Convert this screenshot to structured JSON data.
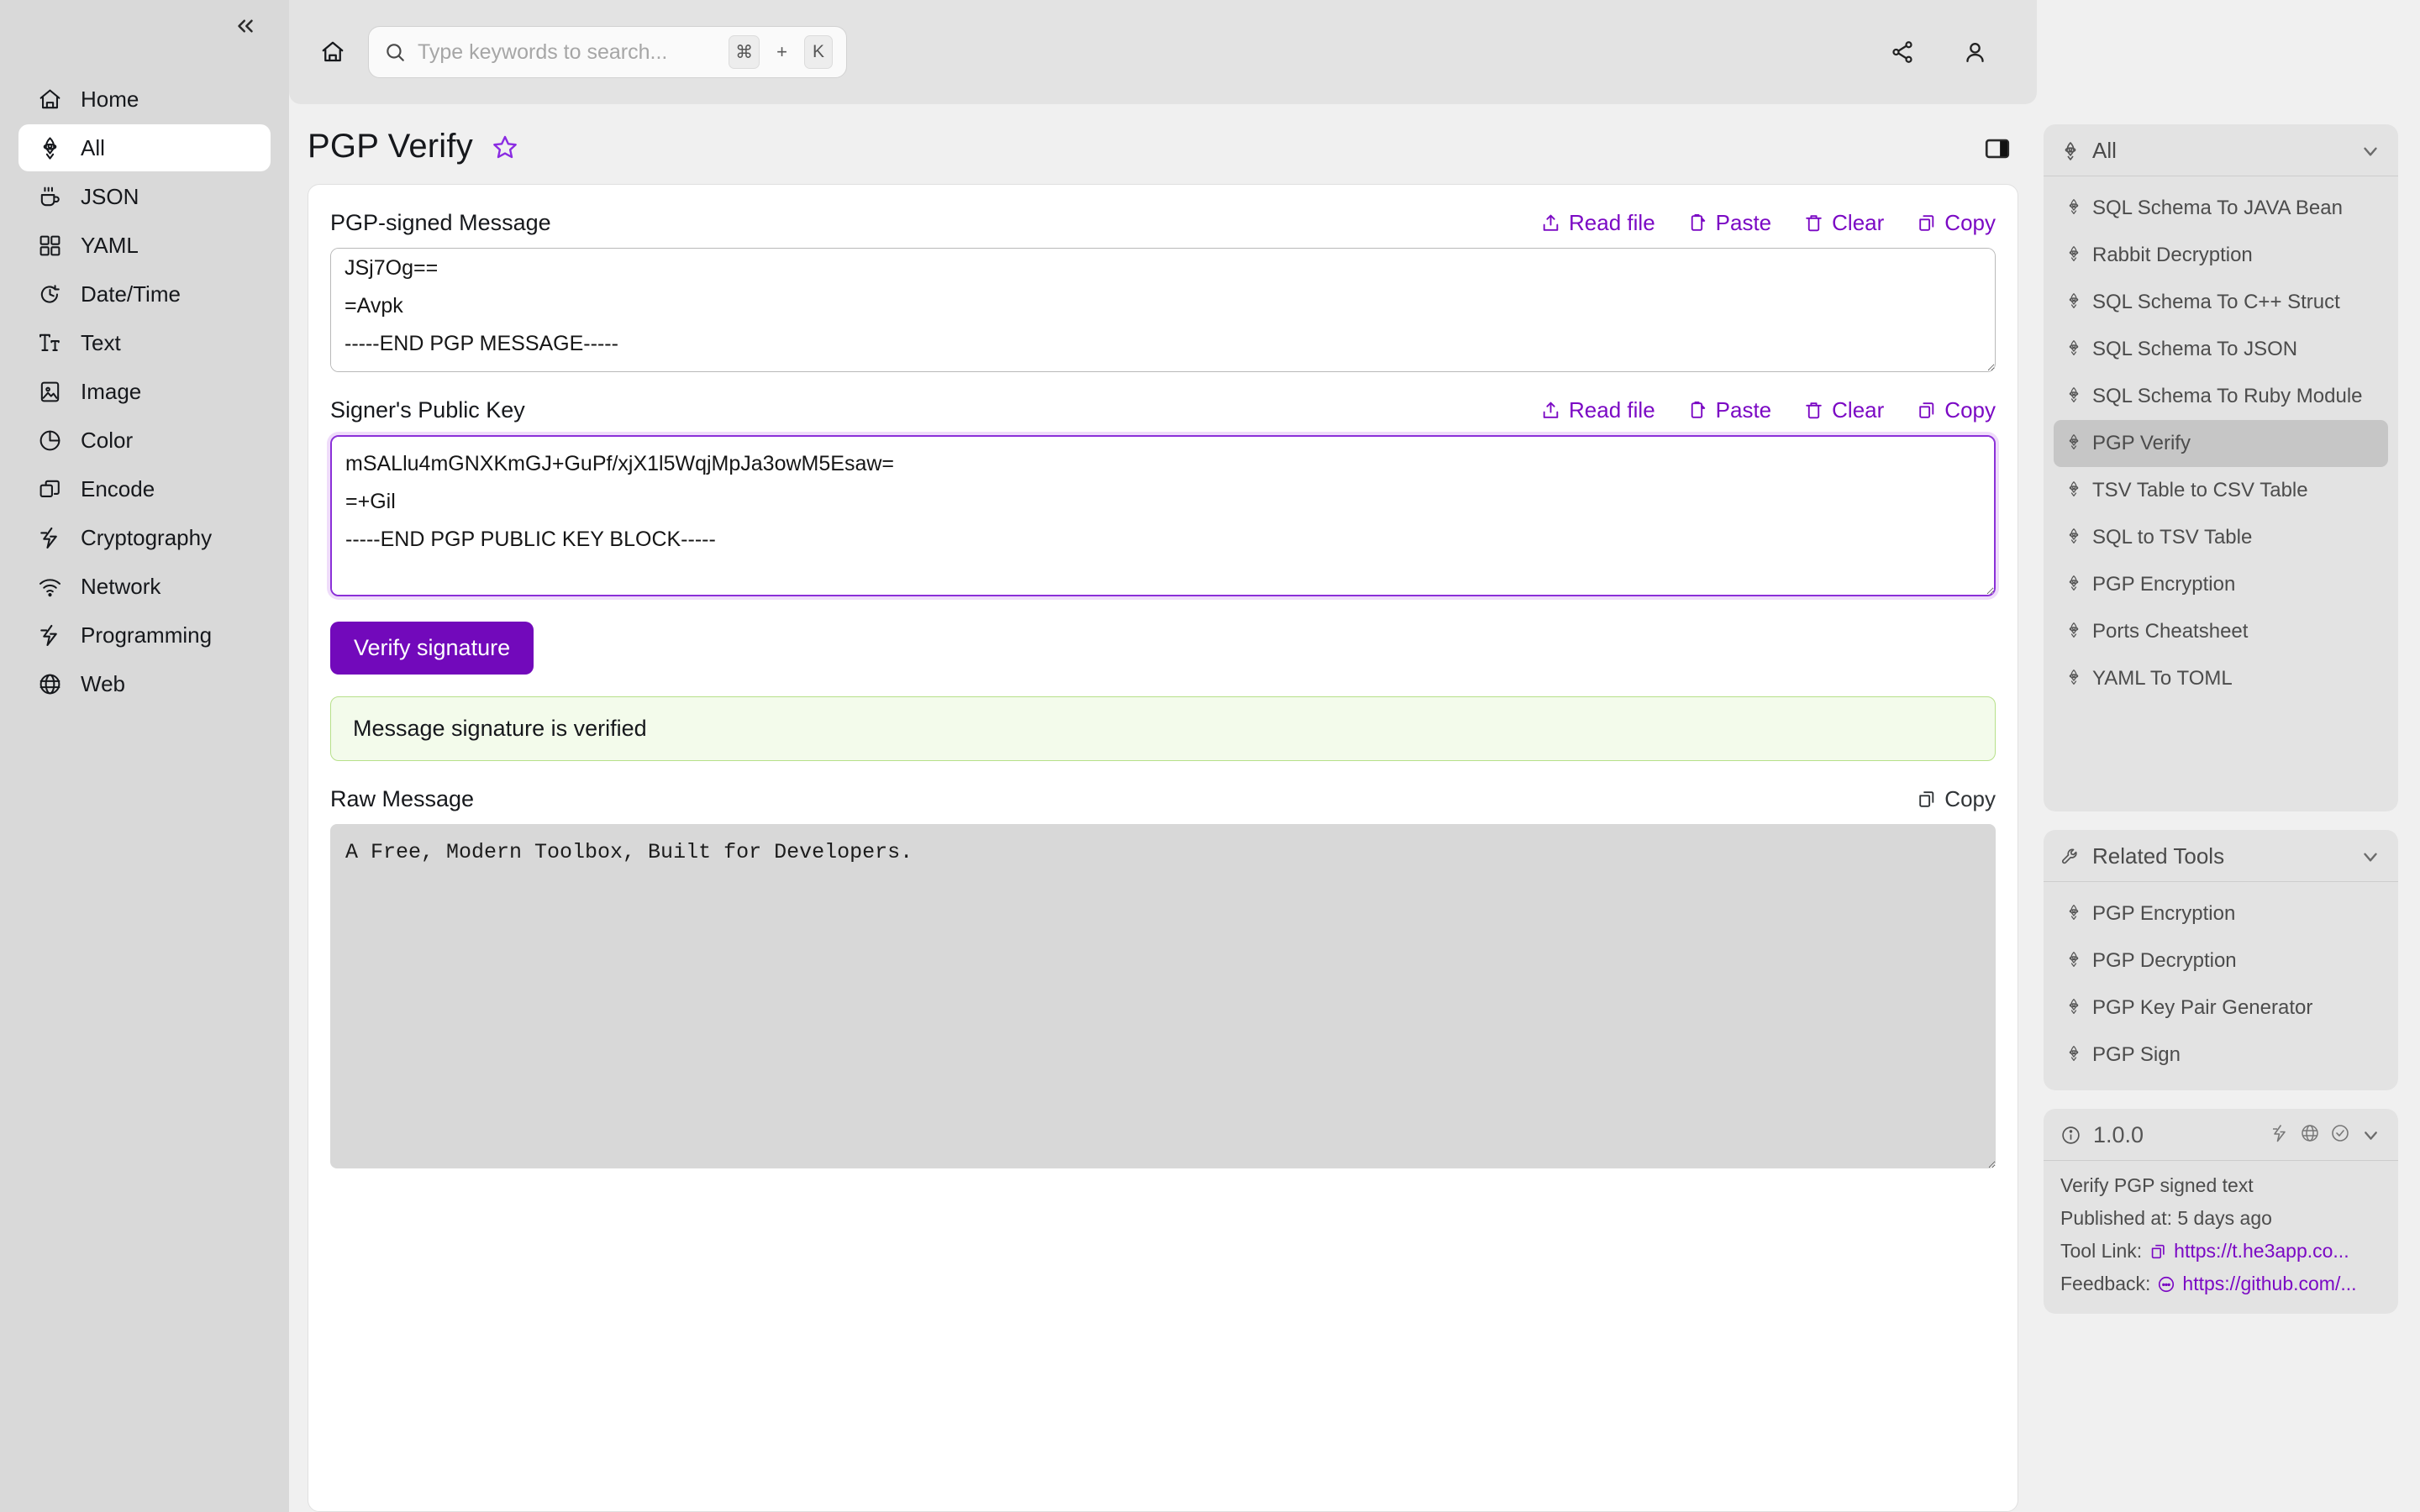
{
  "sidebar": {
    "collapse_icon": "chevrons-left-icon",
    "items": [
      {
        "label": "Home",
        "icon": "home-icon",
        "active": false
      },
      {
        "label": "All",
        "icon": "rocket-icon",
        "active": true
      },
      {
        "label": "JSON",
        "icon": "coffee-icon",
        "active": false
      },
      {
        "label": "YAML",
        "icon": "grid-icon",
        "active": false
      },
      {
        "label": "Date/Time",
        "icon": "clock-icon",
        "active": false
      },
      {
        "label": "Text",
        "icon": "text-icon",
        "active": false
      },
      {
        "label": "Image",
        "icon": "image-icon",
        "active": false
      },
      {
        "label": "Color",
        "icon": "pie-chart-icon",
        "active": false
      },
      {
        "label": "Encode",
        "icon": "layers-icon",
        "active": false
      },
      {
        "label": "Cryptography",
        "icon": "bolt-icon",
        "active": false
      },
      {
        "label": "Network",
        "icon": "wifi-icon",
        "active": false
      },
      {
        "label": "Programming",
        "icon": "bolt-icon",
        "active": false
      },
      {
        "label": "Web",
        "icon": "globe-icon",
        "active": false
      }
    ]
  },
  "topbar": {
    "home_icon": "home-icon",
    "search": {
      "placeholder": "Type keywords to search...",
      "value": "",
      "icon": "search-icon",
      "kbd_mod": "⌘",
      "kbd_plus": "+",
      "kbd_key": "K"
    },
    "share_icon": "share-icon",
    "account_icon": "user-icon"
  },
  "page": {
    "title": "PGP Verify",
    "star_icon": "star-icon",
    "panel_toggle_icon": "panel-right-icon"
  },
  "main": {
    "message_field": {
      "label": "PGP-signed Message",
      "value": "JSj7Og==\n=Avpk\n-----END PGP MESSAGE-----",
      "actions": [
        {
          "label": "Read file",
          "icon": "upload-icon"
        },
        {
          "label": "Paste",
          "icon": "clipboard-icon"
        },
        {
          "label": "Clear",
          "icon": "trash-icon"
        },
        {
          "label": "Copy",
          "icon": "copy-icon"
        }
      ]
    },
    "pubkey_field": {
      "label": "Signer's Public Key",
      "value": "mSALlu4mGNXKmGJ+GuPf/xjX1l5WqjMpJa3owM5Esaw=\n=+Gil\n-----END PGP PUBLIC KEY BLOCK-----\n",
      "actions": [
        {
          "label": "Read file",
          "icon": "upload-icon"
        },
        {
          "label": "Paste",
          "icon": "clipboard-icon"
        },
        {
          "label": "Clear",
          "icon": "trash-icon"
        },
        {
          "label": "Copy",
          "icon": "copy-icon"
        }
      ]
    },
    "verify_button": "Verify signature",
    "status_message": "Message signature is verified",
    "raw_field": {
      "label": "Raw Message",
      "value": "A Free, Modern Toolbox, Built for Developers.",
      "copy_label": "Copy",
      "copy_icon": "copy-icon"
    }
  },
  "right": {
    "tools_panel": {
      "title": "All",
      "icon": "rocket-icon",
      "chevron_icon": "chevron-down-icon",
      "items": [
        {
          "label": "SQL Schema To JAVA Bean",
          "active": false
        },
        {
          "label": "Rabbit Decryption",
          "active": false
        },
        {
          "label": "SQL Schema To C++ Struct",
          "active": false
        },
        {
          "label": "SQL Schema To JSON",
          "active": false
        },
        {
          "label": "SQL Schema To Ruby Module",
          "active": false
        },
        {
          "label": "PGP Verify",
          "active": true
        },
        {
          "label": "TSV Table to CSV Table",
          "active": false
        },
        {
          "label": "SQL to TSV Table",
          "active": false
        },
        {
          "label": "PGP Encryption",
          "active": false
        },
        {
          "label": "Ports Cheatsheet",
          "active": false
        },
        {
          "label": "YAML To TOML",
          "active": false
        }
      ]
    },
    "related_panel": {
      "title": "Related Tools",
      "icon": "wrench-icon",
      "chevron_icon": "chevron-down-icon",
      "items": [
        {
          "label": "PGP Encryption"
        },
        {
          "label": "PGP Decryption"
        },
        {
          "label": "PGP Key Pair Generator"
        },
        {
          "label": "PGP Sign"
        }
      ]
    },
    "info_panel": {
      "version": "1.0.0",
      "info_icon": "info-circle-icon",
      "head_icons": [
        "bolt-icon",
        "globe-icon",
        "check-circle-icon",
        "chevron-down-icon"
      ],
      "description": "Verify PGP signed text",
      "published": "Published at: 5 days ago",
      "tool_link_label": "Tool Link:",
      "tool_link_url": "https://t.he3app.co...",
      "tool_link_icon": "copy-icon",
      "feedback_label": "Feedback:",
      "feedback_url": "https://github.com/...",
      "feedback_icon": "message-icon"
    }
  },
  "colors": {
    "accent": "#7209bb",
    "link": "#7b09c4",
    "success_bg": "#f3fbeb",
    "success_border": "#b7e08a"
  }
}
